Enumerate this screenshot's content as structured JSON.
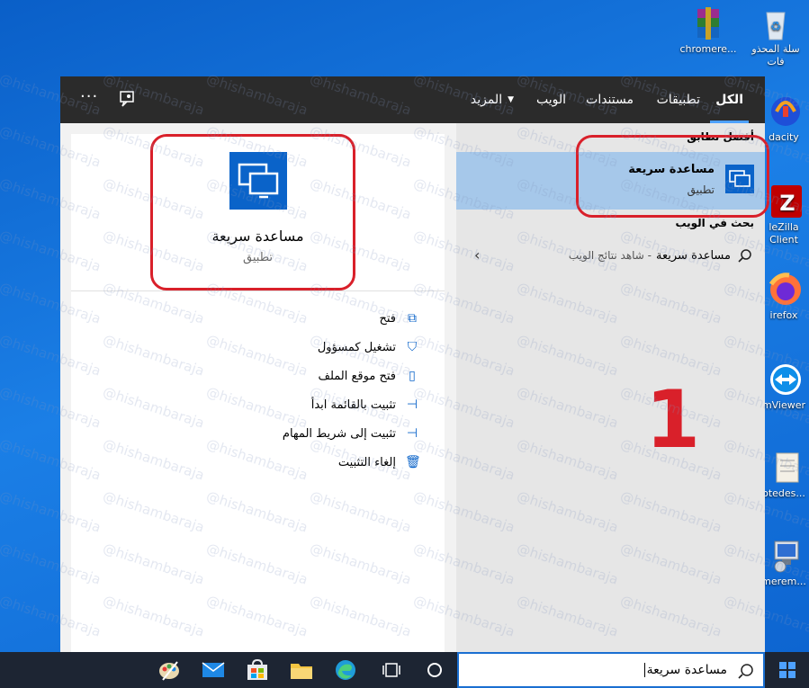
{
  "desktop": {
    "icons": [
      {
        "label": "chromere...",
        "name": "winrar-icon"
      },
      {
        "label": "سلة المحذو\nفات",
        "name": "recycle-bin-icon"
      },
      {
        "label": "dacity",
        "name": "audacity-icon"
      },
      {
        "label": "leZilla\nClient",
        "name": "filezilla-icon"
      },
      {
        "label": "irefox",
        "name": "firefox-icon"
      },
      {
        "label": "mViewer",
        "name": "teamviewer-icon"
      },
      {
        "label": "otedes...",
        "name": "notepad-icon"
      },
      {
        "label": "merem...",
        "name": "chromeremote-icon"
      }
    ]
  },
  "tabs": [
    "الكل",
    "تطبيقات",
    "مستندات",
    "الويب",
    "المزيد"
  ],
  "topbar": {
    "more_icon": "ellipsis-icon",
    "feedback_icon": "feedback-icon"
  },
  "results": {
    "best_match_label": "أفضل تطابق",
    "best_match": {
      "title": "مساعدة سريعة",
      "subtitle": "تطبيق"
    },
    "web_label": "بحث في الويب",
    "web_item": {
      "query": "مساعدة سريعة",
      "suffix": "- شاهد نتائج الويب"
    }
  },
  "detail": {
    "title": "مساعدة سريعة",
    "subtitle": "تطبيق",
    "actions": [
      {
        "label": "فتح",
        "icon": "open-icon"
      },
      {
        "label": "تشغيل كمسؤول",
        "icon": "admin-shield-icon"
      },
      {
        "label": "فتح موقع الملف",
        "icon": "file-location-icon"
      },
      {
        "label": "تثبيت بالقائمة ابدأ",
        "icon": "pin-start-icon"
      },
      {
        "label": "تثبيت إلى شريط المهام",
        "icon": "pin-taskbar-icon"
      },
      {
        "label": "إلغاء التثبيت",
        "icon": "trash-icon"
      }
    ]
  },
  "annotation": {
    "number": "1"
  },
  "watermark": "@hishambaraja",
  "search": {
    "value": "مساعدة سريعة"
  },
  "colors": {
    "accent": "#0a63c9",
    "annotation_red": "#d9202a",
    "selected": "#a6c8ea",
    "topbar": "#2b2b2b"
  }
}
